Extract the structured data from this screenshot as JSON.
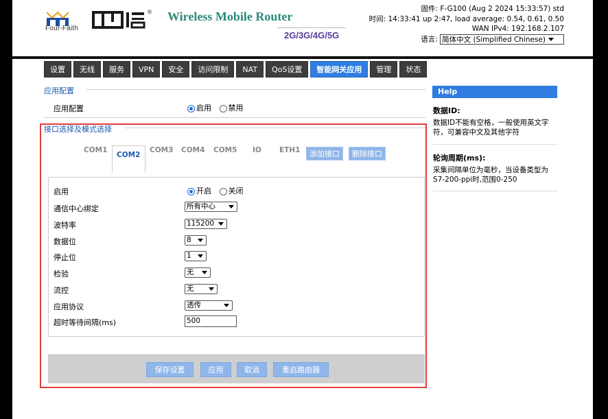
{
  "header": {
    "brand_cn": "四信",
    "brand_en": "Four-Faith",
    "brand_mark": "®",
    "product_title": "Wireless Mobile Router",
    "product_networks": "2G/3G/4G/5G",
    "firmware": "固件: F-G100 (Aug 2 2024 15:33:57) std",
    "time": "时间: 14:33:41 up 2:47, load average: 0.54, 0.61, 0.50",
    "wan": "WAN IPv4: 192.168.2.107",
    "language_label": "语言:",
    "language_value": "简体中文 (Simplified Chinese)"
  },
  "nav": {
    "tabs": [
      {
        "label": "设置",
        "active": false
      },
      {
        "label": "无线",
        "active": false
      },
      {
        "label": "服务",
        "active": false
      },
      {
        "label": "VPN",
        "active": false
      },
      {
        "label": "安全",
        "active": false
      },
      {
        "label": "访问限制",
        "active": false
      },
      {
        "label": "NAT",
        "active": false
      },
      {
        "label": "QoS设置",
        "active": false
      },
      {
        "label": "智能网关应用",
        "active": true
      },
      {
        "label": "管理",
        "active": false
      },
      {
        "label": "状态",
        "active": false
      }
    ]
  },
  "app_config": {
    "legend": "应用配置",
    "label": "应用配置",
    "enable_label": "启用",
    "disable_label": "禁用",
    "selected": "enable"
  },
  "interface": {
    "legend": "接口选择及模式选择",
    "com_tabs": [
      "COM1",
      "COM2",
      "COM3",
      "COM4",
      "COM5",
      "IO",
      "ETH1"
    ],
    "active_tab": "COM2",
    "add_button": "添加接口",
    "delete_button": "删除接口",
    "fields": {
      "enable": {
        "label": "启用",
        "on_label": "开启",
        "off_label": "关闭",
        "selected": "on"
      },
      "center_bind": {
        "label": "通信中心绑定",
        "value": "所有中心"
      },
      "baud": {
        "label": "波特率",
        "value": "115200"
      },
      "data_bits": {
        "label": "数据位",
        "value": "8"
      },
      "stop_bits": {
        "label": "停止位",
        "value": "1"
      },
      "parity": {
        "label": "检验",
        "value": "无"
      },
      "flow": {
        "label": "流控",
        "value": "无"
      },
      "protocol": {
        "label": "应用协议",
        "value": "透传"
      },
      "timeout": {
        "label": "超时等待间隔(ms)",
        "value": "500"
      }
    }
  },
  "actions": {
    "save": "保存设置",
    "apply": "应用",
    "cancel": "取消",
    "reboot": "重启路由器"
  },
  "help": {
    "title": "Help",
    "items": [
      {
        "heading": "数据ID:",
        "text": "数据ID不能有空格，一般使用英文字符，可兼容中文及其他字符"
      },
      {
        "heading": "轮询周期(ms):",
        "text": "采集间隔单位为毫秒，当设备类型为S7-200-ppi时,范围0-250"
      }
    ]
  },
  "colors": {
    "accent": "#2f7de0",
    "highlight_border": "#e23c3c",
    "legend_text": "#1a5cb0"
  }
}
